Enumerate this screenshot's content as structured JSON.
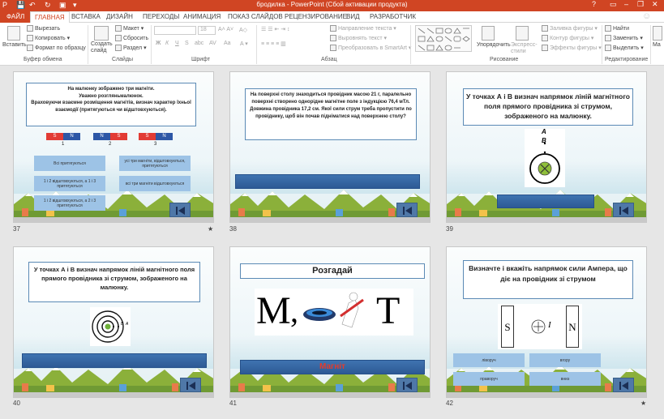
{
  "window": {
    "title": "бродилка -  PowerPoint (Сбой активации продукта)",
    "help": "?",
    "minimize": "–",
    "restore": "❐",
    "close": "✕"
  },
  "tabs": {
    "file": "ФАЙЛ",
    "items": [
      "ГЛАВНАЯ",
      "ВСТАВКА",
      "ДИЗАЙН",
      "ПЕРЕХОДЫ",
      "АНИМАЦИЯ",
      "ПОКАЗ СЛАЙДОВ",
      "РЕЦЕНЗИРОВАНИЕ",
      "ВИД",
      "РАЗРАБОТЧИК"
    ]
  },
  "ribbon": {
    "clipboard": {
      "paste": "Вставить",
      "cut": "Вырезать",
      "copy": "Копировать",
      "format": "Формат по образцу",
      "group": "Буфер обмена"
    },
    "slides": {
      "new": "Создать слайд",
      "layout": "Макет",
      "reset": "Сбросить",
      "section": "Раздел",
      "group": "Слайды"
    },
    "font": {
      "size": "18",
      "bold": "Ж",
      "italic": "К",
      "underline": "Ч",
      "strike": "S",
      "shadow": "abc",
      "spacing": "AV",
      "case": "Aa",
      "group": "Шрифт"
    },
    "paragraph": {
      "direction": "Направление текста",
      "align": "Выровнять текст",
      "smartart": "Преобразовать в SmartArt",
      "group": "Абзац"
    },
    "drawing": {
      "arrange": "Упорядочить",
      "styles": "Экспресс-стили",
      "fill": "Заливка фигуры",
      "outline": "Контур фигуры",
      "effects": "Эффекты фигуры",
      "group": "Рисование"
    },
    "editing": {
      "find": "Найти",
      "replace": "Заменить",
      "select": "Выделить",
      "group": "Редактирование"
    }
  },
  "slides": [
    {
      "num": "37",
      "star": "★",
      "question": "На малюнку зображено три магніти.\nУважно розгляньмалюнок.\nВраховуючи взаємне розміщення магнітів, визнач характер їхньої взаємодії (притягуються чи відштовхуються).",
      "magnets": [
        {
          "l": "S",
          "r": "N",
          "n": "1"
        },
        {
          "l": "N",
          "r": "S",
          "n": "2"
        },
        {
          "l": "S",
          "r": "N",
          "n": "3"
        }
      ],
      "answers": [
        "Всі притягуються",
        "усі три магніти, відштовхуються, притягуються",
        "1 і 2 відштовхуються, а 1 і 3 притягуються",
        "всі три магніти відштовхуються",
        "1 і 2 відштовхуються, а 2 і 3 притягуються"
      ]
    },
    {
      "num": "38",
      "question": "На поверхні столу знаходиться провідник масою 21 г, паралельно поверхні створено однорідне магнітне поле з індукцією 76,4 мТл. Довжина провідника 17,2 см. Якої сили струм треба пропустити по провіднику, щоб він почав підніматися над поверхнею столу?"
    },
    {
      "num": "39",
      "question": "У точках А і В визнач напрямок ліній магнітного поля прямого провідника зі струмом, зображеного на малюнку.",
      "labelA": "А",
      "labelB": "В"
    },
    {
      "num": "40",
      "question": "У точках А і В визнач напрямок ліній магнітного поля прямого провідника зі струмом, зображеного на малюнку.",
      "labelA": "А",
      "labelB": "В"
    },
    {
      "num": "41",
      "title": "Розгадай",
      "puzzle_letters": [
        "М",
        ",",
        "Т"
      ],
      "answer": "Магніт"
    },
    {
      "num": "42",
      "star": "★",
      "question": "Визначте і вкажіть напрямок сили Ампера, що діє на провідник зі струмом",
      "poleS": "S",
      "poleN": "N",
      "current": "I",
      "answers": [
        "ліворуч",
        "вгору",
        "праворуч",
        "вниз"
      ]
    }
  ]
}
